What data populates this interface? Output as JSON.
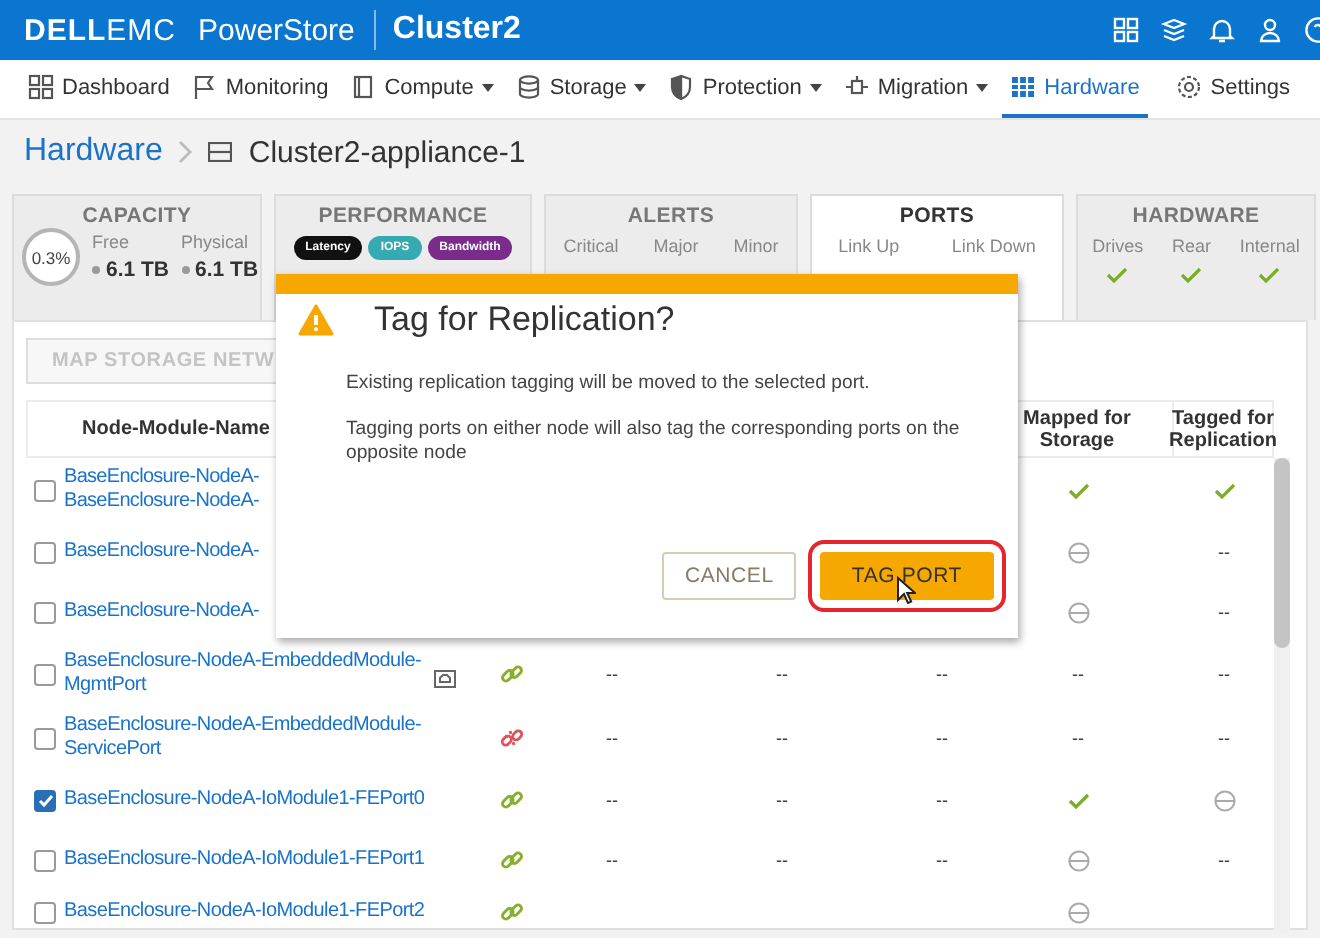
{
  "header": {
    "logo": {
      "brand": "DELL",
      "suffix": "EMC"
    },
    "product": "PowerStore",
    "cluster": "Cluster2"
  },
  "nav": [
    {
      "label": "Dashboard",
      "dropdown": false,
      "selected": false
    },
    {
      "label": "Monitoring",
      "dropdown": false,
      "selected": false
    },
    {
      "label": "Compute",
      "dropdown": true,
      "selected": false
    },
    {
      "label": "Storage",
      "dropdown": true,
      "selected": false
    },
    {
      "label": "Protection",
      "dropdown": true,
      "selected": false
    },
    {
      "label": "Migration",
      "dropdown": true,
      "selected": false
    },
    {
      "label": "Hardware",
      "dropdown": false,
      "selected": true
    }
  ],
  "settings": "Settings",
  "breadcrumb": {
    "parent": "Hardware",
    "current": "Cluster2-appliance-1"
  },
  "cards": [
    {
      "kind": "capacity",
      "title": "CAPACITY",
      "selected": false,
      "donut": "0.3%",
      "stats": [
        {
          "label": "Free",
          "value": "6.1 TB"
        },
        {
          "label": "Physical",
          "value": "6.1 TB"
        }
      ]
    },
    {
      "kind": "performance",
      "title": "PERFORMANCE",
      "selected": false,
      "pills": [
        {
          "label": "Latency",
          "color": "#111111"
        },
        {
          "label": "IOPS",
          "color": "#35aab3"
        },
        {
          "label": "Bandwidth",
          "color": "#7a2b8c"
        }
      ]
    },
    {
      "kind": "labels",
      "title": "ALERTS",
      "selected": false,
      "labels": [
        "Critical",
        "Major",
        "Minor"
      ]
    },
    {
      "kind": "labels",
      "title": "PORTS",
      "selected": true,
      "labels": [
        "Link Up",
        "Link Down"
      ]
    },
    {
      "kind": "status",
      "title": "HARDWARE",
      "selected": false,
      "items": [
        {
          "label": "Drives",
          "ok": true
        },
        {
          "label": "Rear",
          "ok": true
        },
        {
          "label": "Internal",
          "ok": true
        }
      ]
    }
  ],
  "toolbar": {
    "button": {
      "label": "MAP STORAGE NETW",
      "disabled": true
    }
  },
  "table": {
    "columns": {
      "name": "Node-Module-Name",
      "mapped": "Mapped for Storage",
      "tagged": "Tagged for Replication"
    },
    "rows": [
      {
        "selected": false,
        "name_lines": [
          "BaseEnclosure-NodeA-",
          "BaseEnclosure-NodeA-"
        ],
        "mapped": {
          "kind": "check"
        },
        "tagged": {
          "kind": "check"
        }
      },
      {
        "selected": false,
        "name_lines": [
          "BaseEnclosure-NodeA-"
        ],
        "mapped": {
          "kind": "minus"
        },
        "tagged": {
          "kind": "text",
          "text": "--"
        }
      },
      {
        "selected": false,
        "name_lines": [
          "BaseEnclosure-NodeA-"
        ],
        "mapped": {
          "kind": "minus"
        },
        "tagged": {
          "kind": "text",
          "text": "--"
        }
      },
      {
        "selected": false,
        "name_lines": [
          "BaseEnclosure-NodeA-EmbeddedModule-",
          "MgmtPort"
        ],
        "port_icon": true,
        "link_up": true,
        "column_3": "--",
        "column_4": "--",
        "column_5": "--",
        "mapped": {
          "kind": "text",
          "text": "--"
        },
        "tagged": {
          "kind": "text",
          "text": "--"
        }
      },
      {
        "selected": false,
        "name_lines": [
          "BaseEnclosure-NodeA-EmbeddedModule-",
          "ServicePort"
        ],
        "link_up": false,
        "column_3": "--",
        "column_4": "--",
        "column_5": "--",
        "mapped": {
          "kind": "text",
          "text": "--"
        },
        "tagged": {
          "kind": "text",
          "text": "--"
        }
      },
      {
        "selected": true,
        "name_lines": [
          "BaseEnclosure-NodeA-IoModule1-FEPort0"
        ],
        "link_up": true,
        "column_3": "--",
        "column_4": "--",
        "column_5": "--",
        "mapped": {
          "kind": "check"
        },
        "tagged": {
          "kind": "minus"
        }
      },
      {
        "selected": false,
        "name_lines": [
          "BaseEnclosure-NodeA-IoModule1-FEPort1"
        ],
        "link_up": true,
        "column_3": "--",
        "column_4": "--",
        "column_5": "--",
        "mapped": {
          "kind": "minus"
        },
        "tagged": {
          "kind": "text",
          "text": "--"
        }
      },
      {
        "selected": false,
        "name_lines": [
          "BaseEnclosure-NodeA-IoModule1-FEPort2"
        ],
        "link_up": true,
        "mapped": {
          "kind": "minus"
        }
      }
    ]
  },
  "dialog": {
    "title": "Tag for Replication?",
    "paragraphs": [
      "Existing replication tagging will be moved to the selected port.",
      "Tagging ports on either node will also tag the corresponding ports on the opposite node"
    ],
    "buttons": [
      {
        "label": "CANCEL",
        "kind": "secondary",
        "highlighted": false
      },
      {
        "label": "TAG PORT",
        "kind": "primary",
        "highlighted": true
      }
    ]
  }
}
